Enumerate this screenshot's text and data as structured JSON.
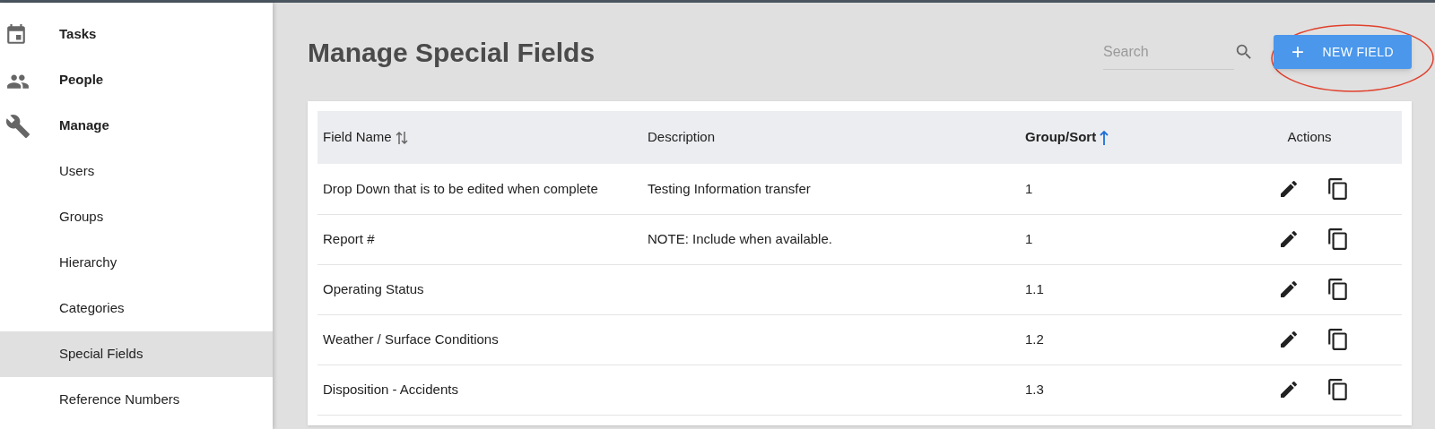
{
  "sidebar": {
    "items": [
      {
        "label": "Tasks",
        "kind": "section",
        "selected": false
      },
      {
        "label": "People",
        "kind": "section",
        "selected": false
      },
      {
        "label": "Manage",
        "kind": "section",
        "selected": false
      },
      {
        "label": "Users",
        "kind": "sub",
        "selected": false
      },
      {
        "label": "Groups",
        "kind": "sub",
        "selected": false
      },
      {
        "label": "Hierarchy",
        "kind": "sub",
        "selected": false
      },
      {
        "label": "Categories",
        "kind": "sub",
        "selected": false
      },
      {
        "label": "Special Fields",
        "kind": "sub",
        "selected": true
      },
      {
        "label": "Reference Numbers",
        "kind": "sub",
        "selected": false
      }
    ]
  },
  "page": {
    "title": "Manage Special Fields",
    "search": {
      "placeholder": "Search"
    },
    "new_button": {
      "icon_text": "+",
      "label": "NEW FIELD"
    },
    "annotation": {
      "kind": "ellipse",
      "color": "#e0402c"
    }
  },
  "table": {
    "columns": [
      {
        "label": "Field Name",
        "sortable": true,
        "sorted": false
      },
      {
        "label": "Description",
        "sortable": false,
        "sorted": false
      },
      {
        "label": "Group/Sort",
        "sortable": true,
        "sorted": true
      },
      {
        "label": "Actions",
        "sortable": false,
        "sorted": false
      }
    ],
    "rows": [
      {
        "field_name": "Drop Down that is to be edited when complete",
        "description": "Testing Information transfer",
        "group_sort": "1"
      },
      {
        "field_name": "Report #",
        "description": "NOTE: Include when available.",
        "group_sort": "1"
      },
      {
        "field_name": "Operating Status",
        "group_sort": "1.1"
      },
      {
        "field_name": "Weather / Surface Conditions",
        "group_sort": "1.2"
      },
      {
        "field_name": "Disposition - Accidents",
        "group_sort": "1.3"
      }
    ]
  }
}
